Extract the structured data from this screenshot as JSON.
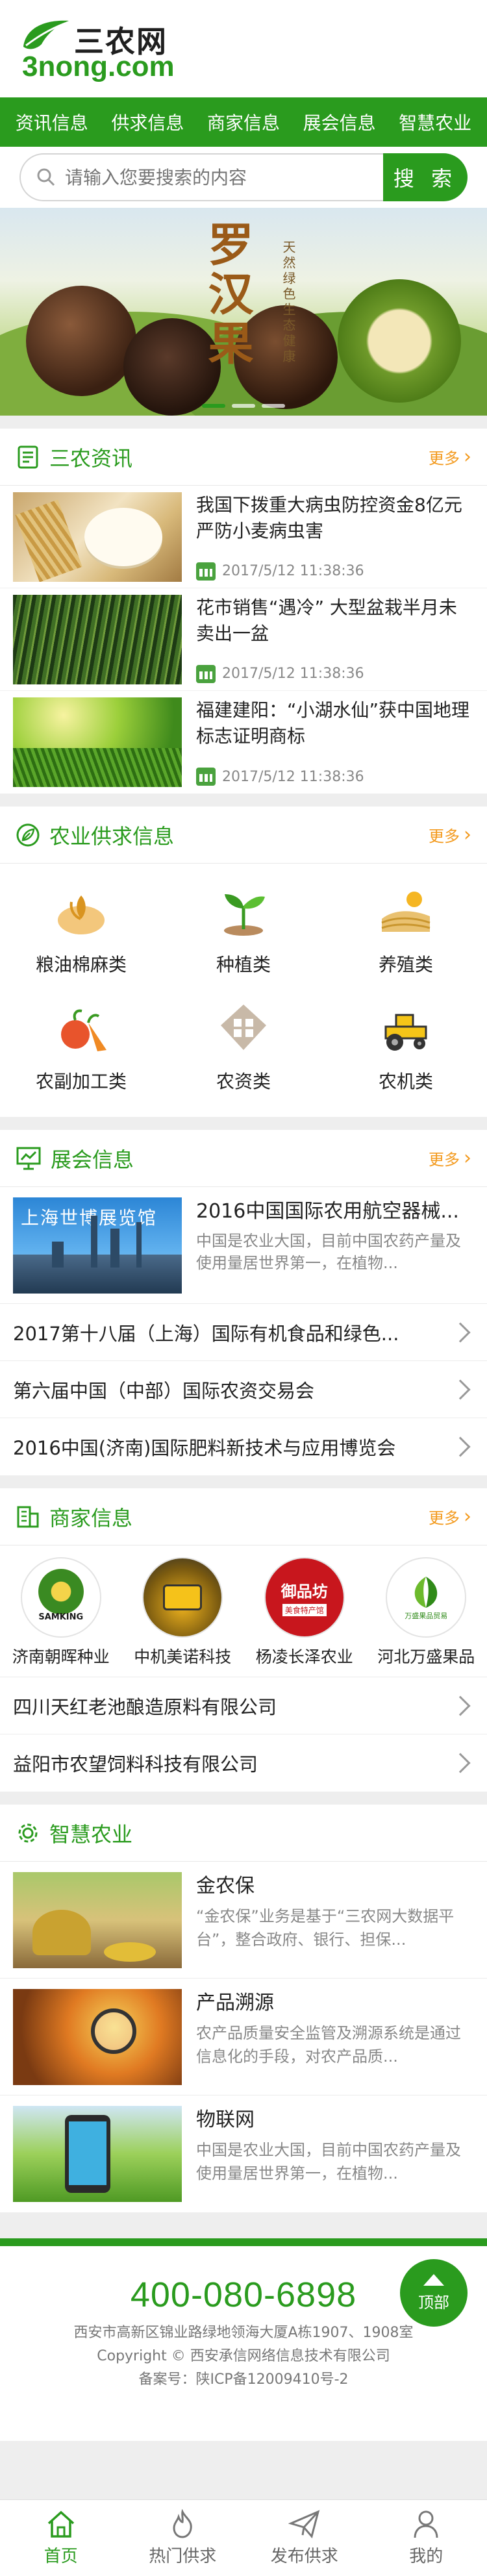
{
  "header": {
    "logo_cn": "三农网",
    "logo_en": "3nong.com"
  },
  "nav": [
    "资讯信息",
    "供求信息",
    "商家信息",
    "展会信息",
    "智慧农业"
  ],
  "search": {
    "placeholder": "请输入您要搜索的内容",
    "button": "搜 索"
  },
  "banner": {
    "title": "罗汉果",
    "subtitle": "天然绿色生态健康"
  },
  "news": {
    "title": "三农资讯",
    "more": "更多",
    "items": [
      {
        "title": "我国下拨重大病虫防控资金8亿元 严防小麦病虫害",
        "time": "2017/5/12 11:38:36"
      },
      {
        "title": "花市销售“遇冷” 大型盆栽半月未卖出一盆",
        "time": "2017/5/12 11:38:36"
      },
      {
        "title": "福建建阳：“小湖水仙”获中国地理标志证明商标",
        "time": "2017/5/12 11:38:36"
      }
    ]
  },
  "supply": {
    "title": "农业供求信息",
    "more": "更多",
    "items": [
      "粮油棉麻类",
      "种植类",
      "养殖类",
      "农副加工类",
      "农资类",
      "农机类"
    ]
  },
  "expo": {
    "title": "展会信息",
    "more": "更多",
    "feature": {
      "thumb_text": "上海世博展览馆",
      "title": "2016中国国际农用航空器械...",
      "desc": "中国是农业大国，目前中国农药产量及使用量居世界第一，在植物..."
    },
    "list": [
      "2017第十八届（上海）国际有机食品和绿色...",
      "第六届中国（中部）国际农资交易会",
      "2016中国(济南)国际肥料新技术与应用博览会"
    ]
  },
  "merchants": {
    "title": "商家信息",
    "more": "更多",
    "logos": [
      {
        "name": "济南朝晖种业",
        "logo_text": "SAMKING"
      },
      {
        "name": "中机美诺科技",
        "logo_text": ""
      },
      {
        "name": "杨凌长泽农业",
        "logo_text": "御品坊",
        "logo_sub": "美食特产馆"
      },
      {
        "name": "河北万盛果品",
        "logo_text": "万盛果品贸易"
      }
    ],
    "list": [
      "四川天红老池酿造原料有限公司",
      "益阳市农望饲料科技有限公司"
    ]
  },
  "smart": {
    "title": "智慧农业",
    "items": [
      {
        "title": "金农保",
        "desc": "“金农保”业务是基于“三农网大数据平台”，整合政府、银行、担保..."
      },
      {
        "title": "产品溯源",
        "desc": "农产品质量安全监管及溯源系统是通过信息化的手段，对农产品质..."
      },
      {
        "title": "物联网",
        "desc": "中国是农业大国，目前中国农药产量及使用量居世界第一，在植物..."
      }
    ]
  },
  "footer": {
    "phone": "400-080-6898",
    "address": "西安市高新区锦业路绿地领海大厦A栋1907、1908室",
    "copyright": "Copyright © 西安承信网络信息技术有限公司",
    "icp": "备案号：陕ICP备12009410号-2",
    "top_label": "顶部"
  },
  "tabbar": [
    "首页",
    "热门供求",
    "发布供求",
    "我的"
  ],
  "colors": {
    "primary": "#2a9b1e",
    "more": "#f39a1e"
  }
}
